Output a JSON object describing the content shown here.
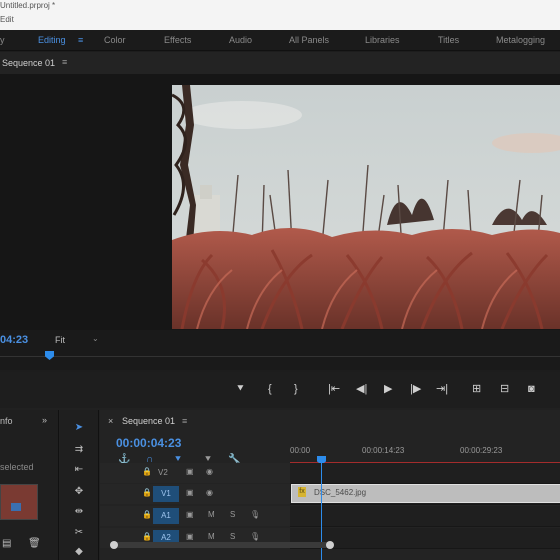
{
  "titlebar": {
    "line1": "Untitled.prproj *",
    "line2": "Edit"
  },
  "workspaces": [
    {
      "label": "y",
      "active": false
    },
    {
      "label": "Editing",
      "active": true
    },
    {
      "label": "Color",
      "active": false
    },
    {
      "label": "Effects",
      "active": false
    },
    {
      "label": "Audio",
      "active": false
    },
    {
      "label": "All Panels",
      "active": false
    },
    {
      "label": "Libraries",
      "active": false
    },
    {
      "label": "Titles",
      "active": false
    },
    {
      "label": "Metalogging",
      "active": false
    }
  ],
  "program_monitor": {
    "tab_label": "Sequence 01",
    "timecode": "04:23",
    "fit_label": "Fit"
  },
  "project_panel": {
    "tab_label": "nfo",
    "selection_label": "selected"
  },
  "sequence": {
    "tab_label": "Sequence 01",
    "timecode": "00:00:04:23",
    "ruler": [
      "00:00",
      "00:00:14:23",
      "00:00:29:23"
    ],
    "clip_name": "DSC_5462.jpg",
    "tracks": [
      {
        "chip": "V2",
        "type": "video"
      },
      {
        "chip": "V1",
        "type": "video"
      },
      {
        "chip": "A1",
        "type": "audio"
      },
      {
        "chip": "A2",
        "type": "audio"
      }
    ],
    "audio_buttons": {
      "mute": "M",
      "solo": "S"
    }
  },
  "colors": {
    "accent_blue": "#4a90e2",
    "playhead_blue": "#2d8ceb",
    "clip": "#bdbdbd",
    "track_chip": "#1f4e79"
  }
}
